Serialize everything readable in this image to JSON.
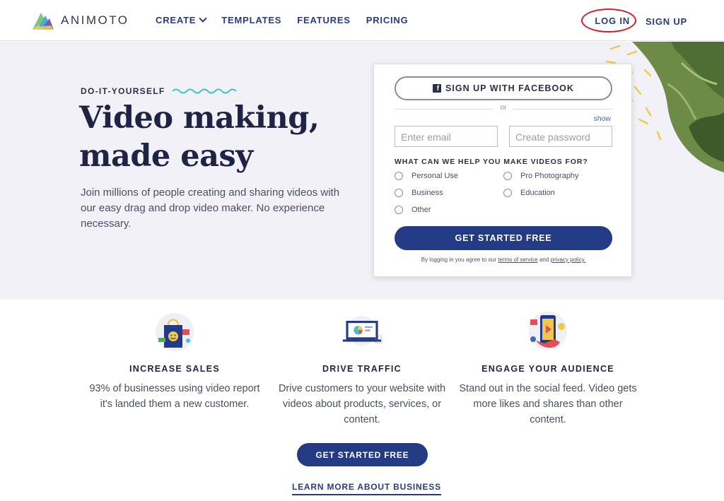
{
  "header": {
    "logo_text": "ANIMOTO",
    "nav": [
      {
        "label": "CREATE"
      },
      {
        "label": "TEMPLATES"
      },
      {
        "label": "FEATURES"
      },
      {
        "label": "PRICING"
      }
    ],
    "login_label": "LOG IN",
    "signup_label": "SIGN UP"
  },
  "hero": {
    "eyebrow": "DO-IT-YOURSELF",
    "headline_line1": "Video making,",
    "headline_line2": "made easy",
    "subtext": "Join millions of people creating and sharing videos with our easy drag and drop video maker. No experience necessary."
  },
  "form": {
    "facebook_label": "SIGN UP WITH FACEBOOK",
    "or_text": "or",
    "show_label": "show",
    "email_placeholder": "Enter email",
    "password_placeholder": "Create password",
    "question": "WHAT CAN WE HELP YOU MAKE VIDEOS FOR?",
    "options": [
      "Personal Use",
      "Pro Photography",
      "Business",
      "Education",
      "Other"
    ],
    "cta_label": "GET STARTED FREE",
    "terms_prefix": "By logging in you agree to our",
    "terms_link": "terms of service",
    "terms_and": "and",
    "privacy_link": "privacy policy."
  },
  "features": [
    {
      "title": "INCREASE SALES",
      "text": "93% of businesses using video report it's landed them a new customer."
    },
    {
      "title": "DRIVE TRAFFIC",
      "text": "Drive customers to your website with videos about products, services, or content."
    },
    {
      "title": "ENGAGE YOUR AUDIENCE",
      "text": "Stand out in the social feed. Video gets more likes and shares than other content."
    }
  ],
  "bottom": {
    "cta_label": "GET STARTED FREE",
    "learn_more_label": "LEARN MORE ABOUT BUSINESS"
  },
  "colors": {
    "brand_navy": "#233a85",
    "login_highlight": "#d71a2b",
    "hero_bg": "#f1f1f7"
  }
}
